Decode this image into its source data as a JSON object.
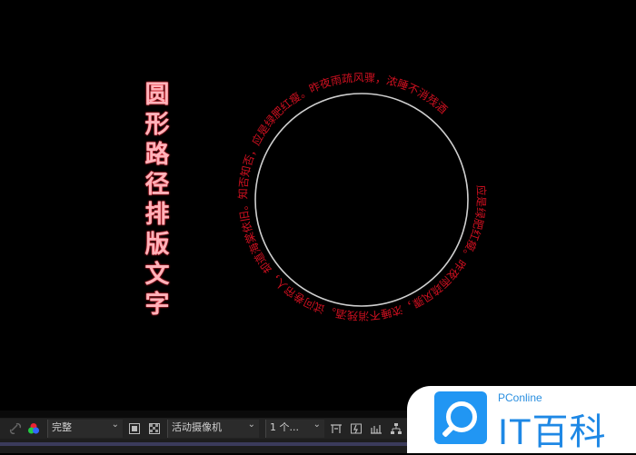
{
  "artwork": {
    "vertical_title": [
      "圆",
      "形",
      "路",
      "径",
      "排",
      "版",
      "文",
      "字"
    ],
    "ring_text": "应是绿肥红瘦。昨夜雨疏风骤，浓睡不消残酒。试问卷帘人，却道海棠依旧。知否知否，应是绿肥红瘦。昨夜雨疏风骤，浓睡不消残酒"
  },
  "toolbar": {
    "quality_select": "完整",
    "camera_select": "活动摄像机",
    "views_select": "1 个..."
  },
  "watermark": {
    "small": "PConline",
    "brand": "IT百科"
  }
}
